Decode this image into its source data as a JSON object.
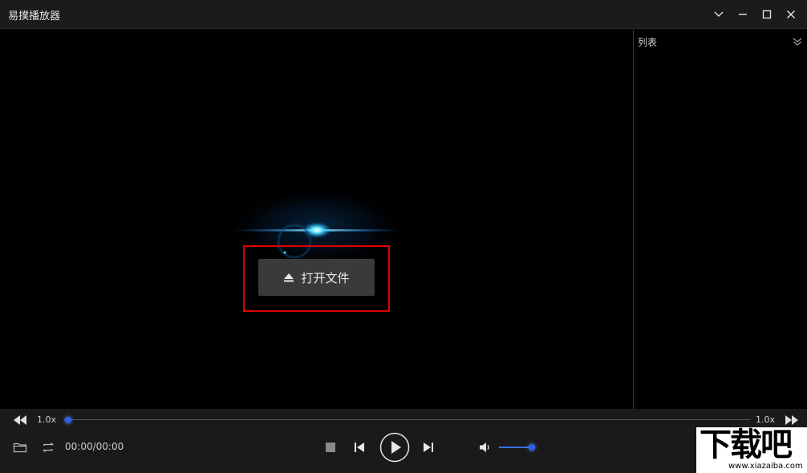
{
  "window": {
    "title": "易撲播放器"
  },
  "player": {
    "open_file_label": "打开文件"
  },
  "playlist": {
    "title": "列表"
  },
  "controls": {
    "speed_left": "1.0x",
    "speed_right": "1.0x",
    "time": "00:00/00:00",
    "progress": 0.006,
    "volume": 0.9
  },
  "watermark": {
    "main": "下载吧",
    "sub": "www.xiazaiba.com"
  },
  "colors": {
    "accent": "#3b6fe0",
    "highlight_box": "#e00000"
  },
  "icons": {
    "collapse": "chevron-down-icon",
    "minimize": "minimize-icon",
    "maximize": "maximize-icon",
    "close": "close-icon",
    "eject": "eject-icon",
    "rewind": "rewind-icon",
    "forward": "fast-forward-icon",
    "folder": "folder-icon",
    "loop": "loop-icon",
    "stop": "stop-icon",
    "prev": "previous-icon",
    "play": "play-icon",
    "next": "next-icon",
    "volume": "volume-icon"
  }
}
